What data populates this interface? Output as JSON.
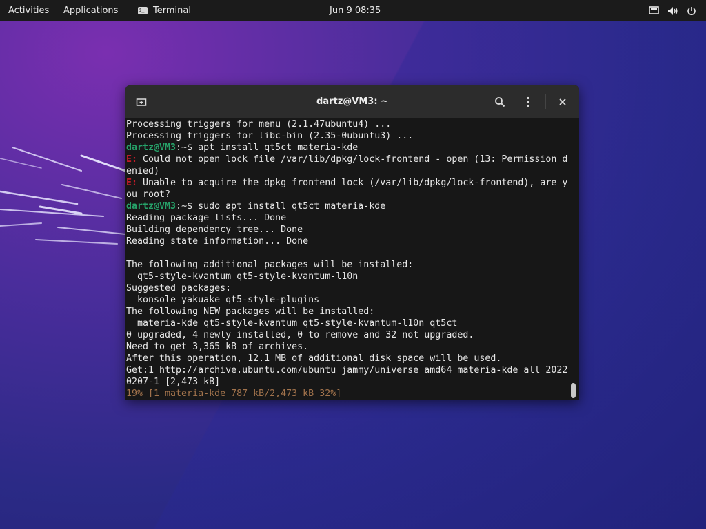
{
  "topbar": {
    "activities": "Activities",
    "applications": "Applications",
    "app_name": "Terminal",
    "app_icon_text": "$_",
    "clock": "Jun 9  08:35"
  },
  "window": {
    "title": "dartz@VM3: ~"
  },
  "terminal": {
    "lines": [
      {
        "text": "Processing triggers for menu (2.1.47ubuntu4) ..."
      },
      {
        "text": "Processing triggers for libc-bin (2.35-0ubuntu3) ..."
      },
      {
        "prompt": "dartz@VM3",
        "sep": ":~$ ",
        "text": "apt install qt5ct materia-kde"
      },
      {
        "err": "E:",
        "text": " Could not open lock file /var/lib/dpkg/lock-frontend - open (13: Permission d"
      },
      {
        "text": "enied)"
      },
      {
        "err": "E:",
        "text": " Unable to acquire the dpkg frontend lock (/var/lib/dpkg/lock-frontend), are y"
      },
      {
        "text": "ou root?"
      },
      {
        "prompt": "dartz@VM3",
        "sep": ":~$ ",
        "text": "sudo apt install qt5ct materia-kde"
      },
      {
        "text": "Reading package lists... Done"
      },
      {
        "text": "Building dependency tree... Done"
      },
      {
        "text": "Reading state information... Done"
      },
      {
        "text": ""
      },
      {
        "text": "The following additional packages will be installed:"
      },
      {
        "text": "  qt5-style-kvantum qt5-style-kvantum-l10n"
      },
      {
        "text": "Suggested packages:"
      },
      {
        "text": "  konsole yakuake qt5-style-plugins"
      },
      {
        "text": "The following NEW packages will be installed:"
      },
      {
        "text": "  materia-kde qt5-style-kvantum qt5-style-kvantum-l10n qt5ct"
      },
      {
        "text": "0 upgraded, 4 newly installed, 0 to remove and 32 not upgraded."
      },
      {
        "text": "Need to get 3,365 kB of archives."
      },
      {
        "text": "After this operation, 12.1 MB of additional disk space will be used."
      },
      {
        "text": "Get:1 http://archive.ubuntu.com/ubuntu jammy/universe amd64 materia-kde all 2022"
      },
      {
        "text": "0207-1 [2,473 kB]"
      },
      {
        "progress": "19% [1 materia-kde 787 kB/2,473 kB 32%]"
      }
    ]
  },
  "colors": {
    "prompt": "#26a269",
    "error": "#c01c28",
    "progress": "#a2734c",
    "terminal_bg": "#171717"
  },
  "icons": [
    "new-tab-icon",
    "search-icon",
    "hamburger-menu-icon",
    "close-icon",
    "screen-icon",
    "volume-icon",
    "power-icon"
  ]
}
